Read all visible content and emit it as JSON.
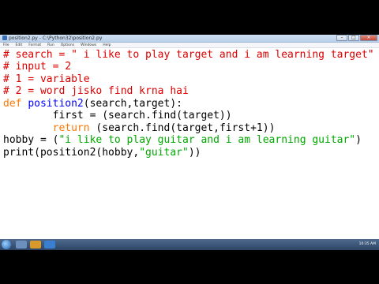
{
  "window": {
    "title": "position2.py - C:\\Python32\\position2.py"
  },
  "menu": [
    "File",
    "Edit",
    "Format",
    "Run",
    "Options",
    "Windows",
    "Help"
  ],
  "code": {
    "l1": "# search = \" i like to play target and i am learning target\"",
    "l2": "# input = 2",
    "l3": "# 1 = variable",
    "l4": "# 2 = word jisko find krna hai",
    "l5_kw": "def",
    "l5_name": "position2",
    "l5_rest": "(search,target):",
    "l6": "        first = (search.find(target))",
    "l7_indent": "        ",
    "l7_kw": "return",
    "l7_rest": " (search.find(target,first+1))",
    "l8_a": "hobby = (",
    "l8_str": "\"i like to play guitar and i am learning guitar\"",
    "l8_b": ")",
    "l9_a": "print(position2(hobby,",
    "l9_str": "\"guitar\"",
    "l9_b": "))"
  },
  "taskbar": {
    "clock": "10:35 AM"
  },
  "colors": {
    "comment": "#dd0000",
    "keyword": "#ff7700",
    "defname": "#0000ff",
    "string": "#00aa00"
  }
}
